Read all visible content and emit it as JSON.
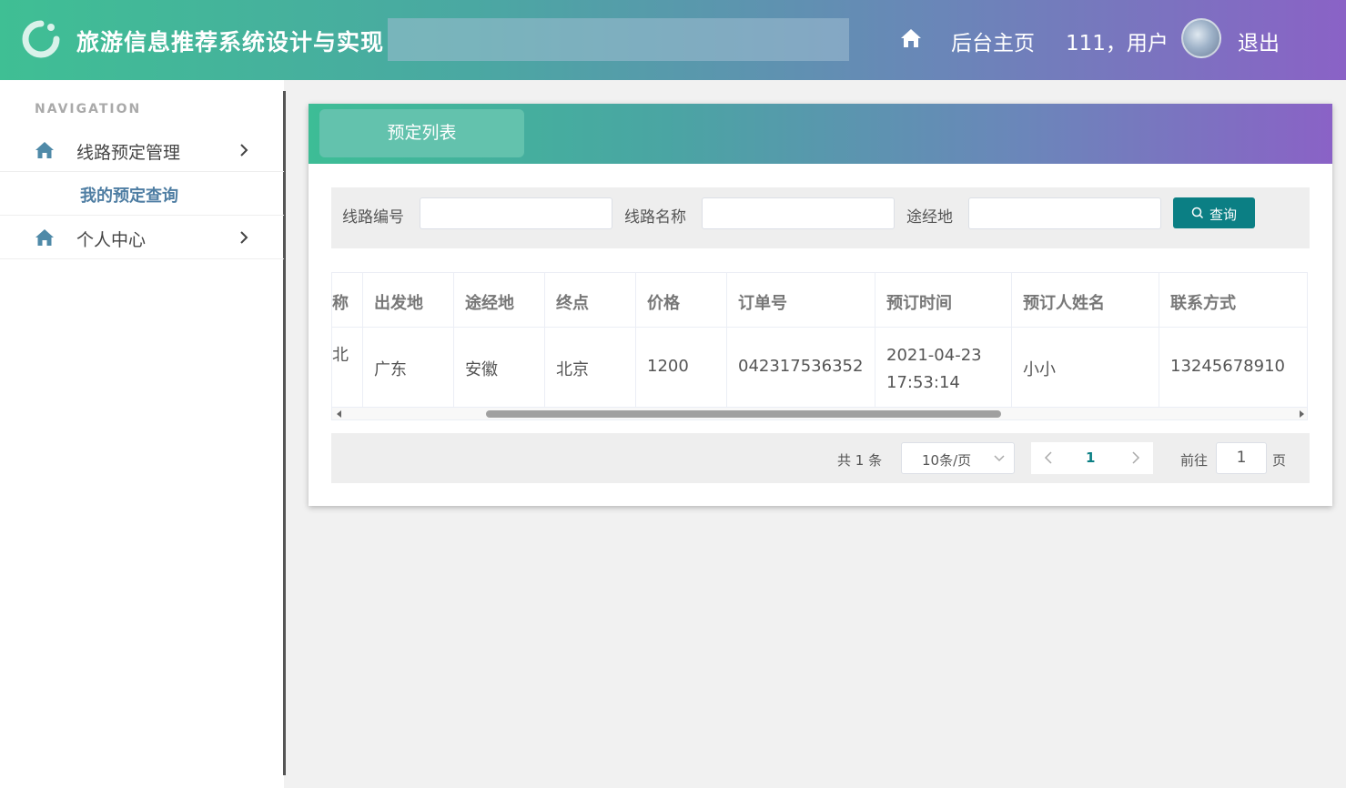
{
  "header": {
    "title": "旅游信息推荐系统设计与实现",
    "home_label": "后台主页",
    "user_label": "111，用户",
    "logout_label": "退出",
    "icons": [
      "logo-icon",
      "home-icon",
      "avatar"
    ]
  },
  "sidebar": {
    "nav_title": "NAVIGATION",
    "items": [
      {
        "label": "线路预定管理",
        "icon": "home-icon",
        "children": [
          {
            "label": "我的预定查询"
          }
        ]
      },
      {
        "label": "个人中心",
        "icon": "home-icon"
      }
    ]
  },
  "panel": {
    "tab_label": "预定列表"
  },
  "search": {
    "route_no_label": "线路编号",
    "route_name_label": "线路名称",
    "via_label": "途经地",
    "button_label": "查询",
    "route_no_value": "",
    "route_name_value": "",
    "via_value": ""
  },
  "table": {
    "columns": [
      "称",
      "出发地",
      "途经地",
      "终点",
      "价格",
      "订单号",
      "预订时间",
      "预订人姓名",
      "联系方式"
    ],
    "rows": [
      [
        "北",
        "广东",
        "安徽",
        "北京",
        "1200",
        "042317536352",
        "2021-04-23 17:53:14",
        "小小",
        "13245678910"
      ]
    ]
  },
  "pagination": {
    "total_text": "共 1 条",
    "page_size": "10条/页",
    "current_page": "1",
    "goto_label": "前往",
    "goto_value": "1",
    "goto_suffix": "页"
  },
  "colors": {
    "accent": "#0b7f84",
    "header_start": "#3fbf94",
    "header_end": "#8a62c6",
    "sidebar_active": "#4f7ea3"
  }
}
